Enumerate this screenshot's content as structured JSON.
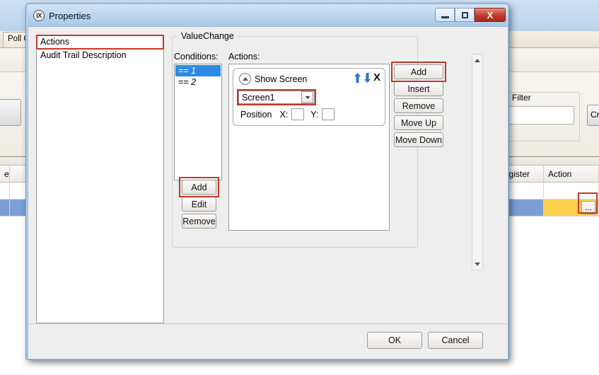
{
  "background": {
    "tab_label": "Poll Gr",
    "filter": {
      "legend": "Filter",
      "input_value": "",
      "create_button": "Cr"
    },
    "grid": {
      "columns": [
        "e",
        "x Register",
        "Action"
      ],
      "rows": [
        {
          "cells": [
            "",
            "",
            ""
          ]
        },
        {
          "cells": [
            "",
            "",
            "..."
          ]
        }
      ],
      "ellipsis_button": "..."
    }
  },
  "dialog": {
    "title": "Properties",
    "icon": "ix-icon",
    "window_controls": {
      "minimize": "minimize-icon",
      "maximize": "maximize-icon",
      "close": "X"
    },
    "categories": [
      {
        "label": "Actions",
        "selected": true
      },
      {
        "label": "Audit Trail Description",
        "selected": false
      }
    ],
    "group": {
      "legend": "ValueChange",
      "conditions_label": "Conditions:",
      "actions_label": "Actions:",
      "conditions": [
        {
          "label": "== 1",
          "selected": true
        },
        {
          "label": "== 2",
          "selected": false
        }
      ],
      "condition_buttons": [
        {
          "label": "Add",
          "highlighted": true
        },
        {
          "label": "Edit",
          "highlighted": false
        },
        {
          "label": "Remove",
          "highlighted": false
        }
      ],
      "action_card": {
        "title": "Show Screen",
        "collapse_icon": "chevron-up-icon",
        "move_up_icon": "arrow-up-icon",
        "move_down_icon": "arrow-down-icon",
        "delete_icon": "X",
        "screen_select_value": "Screen1",
        "position_label": "Position",
        "x_label": "X:",
        "y_label": "Y:",
        "x_value": "",
        "y_value": ""
      },
      "action_buttons": [
        {
          "label": "Add",
          "highlighted": true
        },
        {
          "label": "Insert",
          "highlighted": false
        },
        {
          "label": "Remove",
          "highlighted": false
        },
        {
          "label": "Move Up",
          "highlighted": false
        },
        {
          "label": "Move Down",
          "highlighted": false
        }
      ]
    },
    "footer": {
      "ok": "OK",
      "cancel": "Cancel"
    }
  },
  "colors": {
    "highlight_red": "#c0392b",
    "selection_blue": "#2f8ae0",
    "row_blue": "#7a9fd6",
    "cell_yellow": "#fdd14d",
    "title_blue": "#bdd6ef"
  }
}
